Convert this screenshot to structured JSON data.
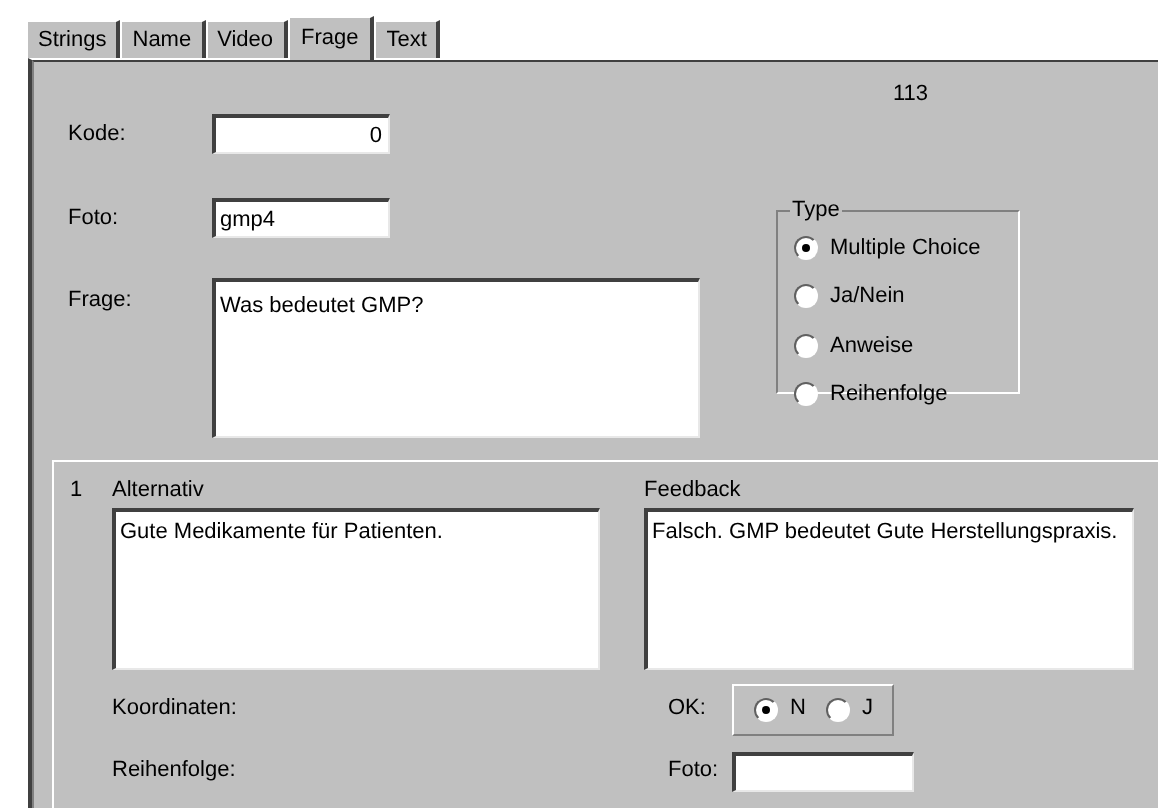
{
  "tabs": [
    {
      "label": "Strings",
      "selected": false
    },
    {
      "label": "Name",
      "selected": false
    },
    {
      "label": "Video",
      "selected": false
    },
    {
      "label": "Frage",
      "selected": true
    },
    {
      "label": "Text",
      "selected": false
    }
  ],
  "record_number": "113",
  "fields": {
    "kode": {
      "label": "Kode:",
      "value": "0"
    },
    "foto": {
      "label": "Foto:",
      "value": "gmp4"
    },
    "frage": {
      "label": "Frage:",
      "value": "Was bedeutet GMP?"
    }
  },
  "type_group": {
    "title": "Type",
    "options": [
      {
        "label": "Multiple Choice",
        "selected": true
      },
      {
        "label": "Ja/Nein",
        "selected": false
      },
      {
        "label": "Anweise",
        "selected": false
      },
      {
        "label": "Reihenfolge",
        "selected": false
      }
    ]
  },
  "alternative": {
    "number": "1",
    "alternativ_label": "Alternativ",
    "alternativ_value": "Gute Medikamente für Patienten.",
    "feedback_label": "Feedback",
    "feedback_value": "Falsch. GMP bedeutet Gute Herstellungspraxis.",
    "koordinaten_label": "Koordinaten:",
    "reihenfolge_label": "Reihenfolge:",
    "ok_label": "OK:",
    "ok_options": [
      {
        "label": "N",
        "selected": true
      },
      {
        "label": "J",
        "selected": false
      }
    ],
    "foto_label": "Foto:"
  }
}
